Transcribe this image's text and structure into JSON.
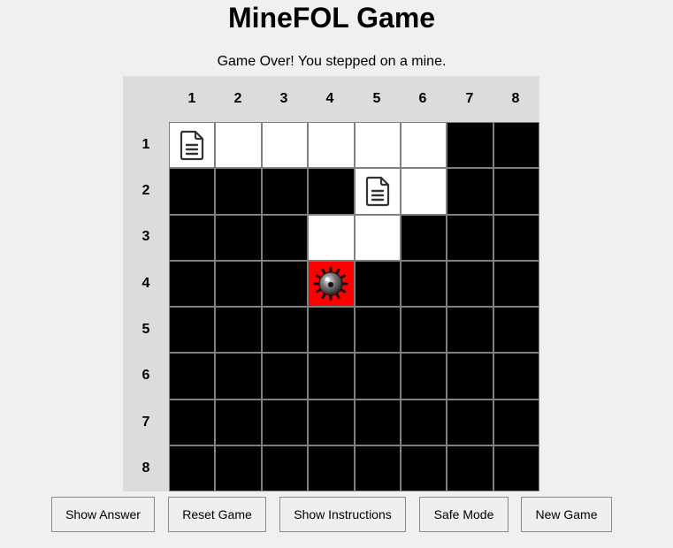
{
  "title": "MineFOL Game",
  "status": "Game Over! You stepped on a mine.",
  "board": {
    "columns": [
      "1",
      "2",
      "3",
      "4",
      "5",
      "6",
      "7",
      "8"
    ],
    "rows": [
      "1",
      "2",
      "3",
      "4",
      "5",
      "6",
      "7",
      "8"
    ],
    "cells": [
      [
        "document",
        "revealed",
        "revealed",
        "revealed",
        "revealed",
        "revealed",
        "hidden",
        "hidden"
      ],
      [
        "hidden",
        "hidden",
        "hidden",
        "hidden",
        "document",
        "revealed",
        "hidden",
        "hidden"
      ],
      [
        "hidden",
        "hidden",
        "hidden",
        "revealed",
        "revealed",
        "hidden",
        "hidden",
        "hidden"
      ],
      [
        "hidden",
        "hidden",
        "hidden",
        "mine",
        "hidden",
        "hidden",
        "hidden",
        "hidden"
      ],
      [
        "hidden",
        "hidden",
        "hidden",
        "hidden",
        "hidden",
        "hidden",
        "hidden",
        "hidden"
      ],
      [
        "hidden",
        "hidden",
        "hidden",
        "hidden",
        "hidden",
        "hidden",
        "hidden",
        "hidden"
      ],
      [
        "hidden",
        "hidden",
        "hidden",
        "hidden",
        "hidden",
        "hidden",
        "hidden",
        "hidden"
      ],
      [
        "hidden",
        "hidden",
        "hidden",
        "hidden",
        "hidden",
        "hidden",
        "hidden",
        "hidden"
      ]
    ],
    "colors": {
      "hidden": "#000000",
      "revealed": "#ffffff",
      "mine": "#ff0000"
    }
  },
  "buttons": {
    "show_answer": "Show Answer",
    "reset_game": "Reset Game",
    "show_instructions": "Show Instructions",
    "safe_mode": "Safe Mode",
    "new_game": "New Game"
  }
}
